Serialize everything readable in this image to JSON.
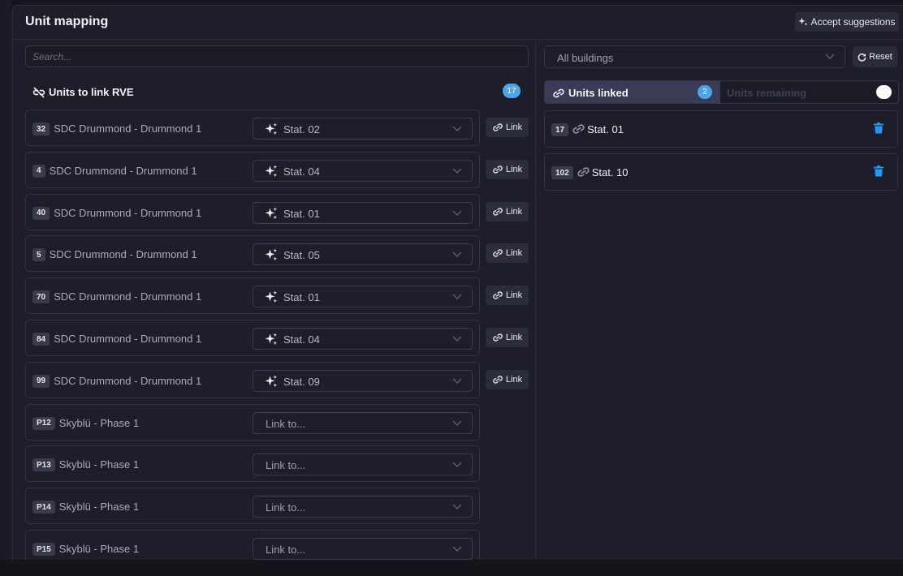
{
  "header": {
    "title": "Unit mapping",
    "accept_label": "Accept suggestions"
  },
  "search": {
    "placeholder": "Search..."
  },
  "units_to_link": {
    "title": "Units to link RVE",
    "count": "17",
    "link_label": "Link",
    "rows": [
      {
        "tag": "32",
        "name": "SDC Drummond - Drummond 1",
        "station": "Stat. 02",
        "suggested": true
      },
      {
        "tag": "4",
        "name": "SDC Drummond - Drummond 1",
        "station": "Stat. 04",
        "suggested": true
      },
      {
        "tag": "40",
        "name": "SDC Drummond - Drummond 1",
        "station": "Stat. 01",
        "suggested": true
      },
      {
        "tag": "5",
        "name": "SDC Drummond - Drummond 1",
        "station": "Stat. 05",
        "suggested": true
      },
      {
        "tag": "70",
        "name": "SDC Drummond - Drummond 1",
        "station": "Stat. 01",
        "suggested": true
      },
      {
        "tag": "84",
        "name": "SDC Drummond - Drummond 1",
        "station": "Stat. 04",
        "suggested": true
      },
      {
        "tag": "99",
        "name": "SDC Drummond - Drummond 1",
        "station": "Stat. 09",
        "suggested": true
      },
      {
        "tag": "P12",
        "name": "Skyblü - Phase 1",
        "station": "Link to...",
        "suggested": false
      },
      {
        "tag": "P13",
        "name": "Skyblü - Phase 1",
        "station": "Link to...",
        "suggested": false
      },
      {
        "tag": "P14",
        "name": "Skyblü - Phase 1",
        "station": "Link to...",
        "suggested": false
      },
      {
        "tag": "P15",
        "name": "Skyblü - Phase 1",
        "station": "Link to...",
        "suggested": false
      }
    ]
  },
  "buildings_filter": {
    "value": "All buildings"
  },
  "reset_label": "Reset",
  "tabs": {
    "linked_label": "Units linked",
    "linked_count": "2",
    "remaining_label": "Units remaining"
  },
  "linked_units": [
    {
      "tag": "17",
      "station": "Stat. 01"
    },
    {
      "tag": "102",
      "station": "Stat. 10"
    }
  ],
  "colors": {
    "accent": "#4aa6ec",
    "trash": "#2196f3",
    "panel": "#1e1e2a"
  }
}
